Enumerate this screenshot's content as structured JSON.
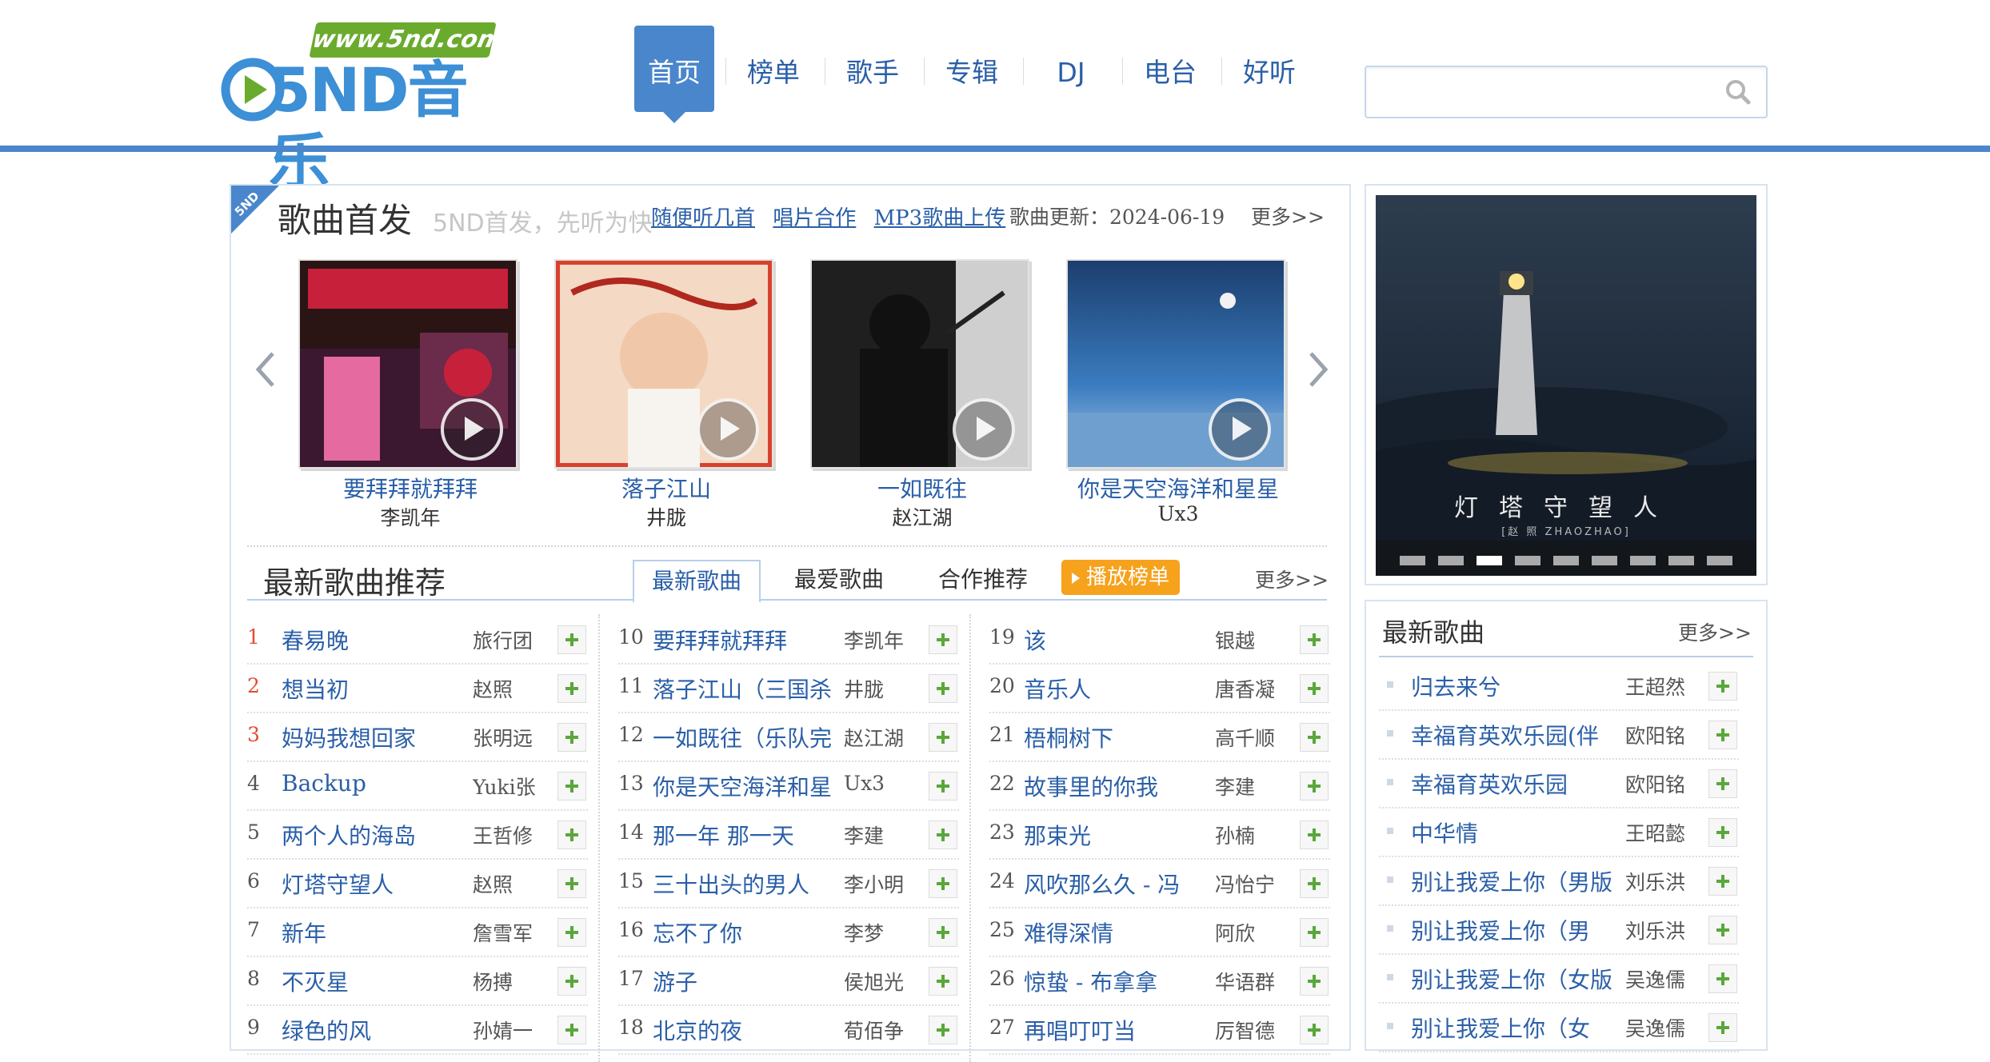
{
  "header": {
    "logo_url": "www.5nd.com",
    "logo_text": "5ND音乐",
    "nav": [
      {
        "label": "首页",
        "active": true
      },
      {
        "label": "榜单"
      },
      {
        "label": "歌手"
      },
      {
        "label": "专辑"
      },
      {
        "label": "DJ"
      },
      {
        "label": "电台"
      },
      {
        "label": "好听"
      }
    ],
    "search": {
      "value": "",
      "placeholder": "",
      "icon": "search-icon"
    }
  },
  "first_release": {
    "badge": "5ND",
    "title": "歌曲首发",
    "subtitle": "5ND首发，先听为快",
    "links": [
      "随便听几首",
      "唱片合作",
      "MP3歌曲上传"
    ],
    "update": "歌曲更新：2024-06-19",
    "more": "更多>>",
    "albums": [
      {
        "title": "要拜拜就拜拜",
        "artist": "李凯年",
        "cover_color": "#c7203b"
      },
      {
        "title": "落子江山",
        "artist": "井胧",
        "cover_color": "#d8412e"
      },
      {
        "title": "一如既往",
        "artist": "赵江湖",
        "cover_color": "#2b2b2b"
      },
      {
        "title": "你是天空海洋和星星",
        "artist": "Ux3",
        "cover_color": "#3a7bc0"
      }
    ]
  },
  "recommend": {
    "title": "最新歌曲推荐",
    "tabs": [
      "最新歌曲",
      "最爱歌曲",
      "合作推荐"
    ],
    "active_tab": 0,
    "play_chart": "播放榜单",
    "more": "更多>>",
    "columns": [
      [
        {
          "num": "1",
          "name": "春易晚",
          "singer": "旅行团"
        },
        {
          "num": "2",
          "name": "想当初",
          "singer": "赵照"
        },
        {
          "num": "3",
          "name": "妈妈我想回家",
          "singer": "张明远"
        },
        {
          "num": "4",
          "name": "Backup",
          "singer": "Yuki张"
        },
        {
          "num": "5",
          "name": "两个人的海岛",
          "singer": "王哲修"
        },
        {
          "num": "6",
          "name": "灯塔守望人",
          "singer": "赵照"
        },
        {
          "num": "7",
          "name": "新年",
          "singer": "詹雪军"
        },
        {
          "num": "8",
          "name": "不灭星",
          "singer": "杨搏"
        },
        {
          "num": "9",
          "name": "绿色的风",
          "singer": "孙婧一"
        }
      ],
      [
        {
          "num": "10",
          "name": "要拜拜就拜拜",
          "singer": "李凯年"
        },
        {
          "num": "11",
          "name": "落子江山（三国杀",
          "singer": "井胧"
        },
        {
          "num": "12",
          "name": "一如既往（乐队完",
          "singer": "赵江湖"
        },
        {
          "num": "13",
          "name": "你是天空海洋和星",
          "singer": "Ux3"
        },
        {
          "num": "14",
          "name": "那一年 那一天",
          "singer": "李建"
        },
        {
          "num": "15",
          "name": "三十出头的男人",
          "singer": "李小明"
        },
        {
          "num": "16",
          "name": "忘不了你",
          "singer": "李梦"
        },
        {
          "num": "17",
          "name": "游子",
          "singer": "侯旭光"
        },
        {
          "num": "18",
          "name": "北京的夜",
          "singer": "荀佰争"
        }
      ],
      [
        {
          "num": "19",
          "name": "该",
          "singer": "银越"
        },
        {
          "num": "20",
          "name": "音乐人",
          "singer": "唐香凝"
        },
        {
          "num": "21",
          "name": "梧桐树下",
          "singer": "高千顺"
        },
        {
          "num": "22",
          "name": "故事里的你我",
          "singer": "李建"
        },
        {
          "num": "23",
          "name": "那束光",
          "singer": "孙楠"
        },
        {
          "num": "24",
          "name": "风吹那么久 - 冯",
          "singer": "冯怡宁"
        },
        {
          "num": "25",
          "name": "难得深情",
          "singer": "阿欣"
        },
        {
          "num": "26",
          "name": "惊蛰 - 布拿拿",
          "singer": "华语群"
        },
        {
          "num": "27",
          "name": "再唱叮叮当",
          "singer": "厉智德"
        }
      ]
    ]
  },
  "banner": {
    "title": "灯塔守望人",
    "subtitle": "[赵 照 ZHAOZHAO]",
    "dot_count": 9,
    "active_dot": 2
  },
  "latest": {
    "title": "最新歌曲",
    "more": "更多>>",
    "items": [
      {
        "name": "归去来兮",
        "singer": "王超然"
      },
      {
        "name": "幸福育英欢乐园(伴",
        "singer": "欧阳铭"
      },
      {
        "name": "幸福育英欢乐园",
        "singer": "欧阳铭"
      },
      {
        "name": "中华情",
        "singer": "王昭懿"
      },
      {
        "name": "别让我爱上你（男版",
        "singer": "刘乐洪"
      },
      {
        "name": "别让我爱上你（男",
        "singer": "刘乐洪"
      },
      {
        "name": "别让我爱上你（女版",
        "singer": "吴逸儒"
      },
      {
        "name": "别让我爱上你（女",
        "singer": "吴逸儒"
      }
    ]
  }
}
